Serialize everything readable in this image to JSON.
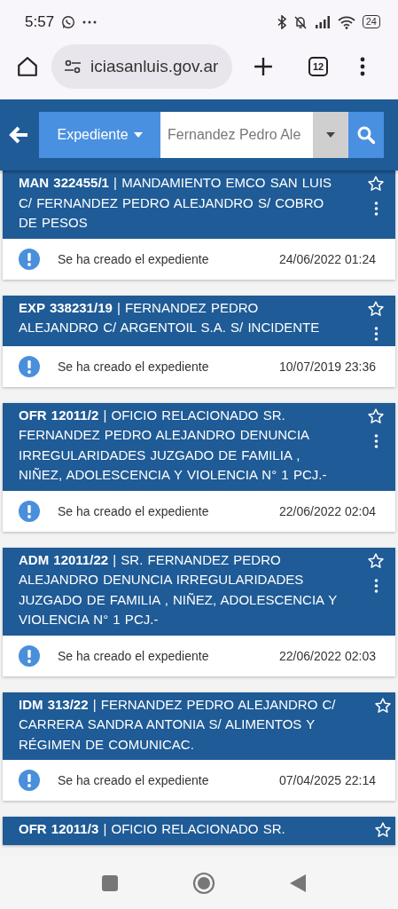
{
  "status_bar": {
    "time": "5:57",
    "battery": "24"
  },
  "browser": {
    "url": "iciasanluis.gov.ar",
    "tab_count": "12"
  },
  "search": {
    "category": "Expediente",
    "value": "Fernandez Pedro Ale"
  },
  "cards": [
    {
      "title": "**MAN 322455/1**   |   MANDAMIENTO EMCO SAN LUIS C/ FERNANDEZ PEDRO ALEJANDRO S/ COBRO DE PESOS",
      "starred": false,
      "menu": true,
      "event": "Se ha creado el expediente",
      "date": "24/06/2022 01:24"
    },
    {
      "title": "**EXP 338231/19**   |   FERNANDEZ PEDRO ALEJANDRO C/ ARGENTOIL S.A. S/ INCIDENTE",
      "starred": false,
      "menu": true,
      "event": "Se ha creado el expediente",
      "date": "10/07/2019 23:36"
    },
    {
      "title": "**OFR 12011/2**   |   OFICIO RELACIONADO SR. FERNANDEZ PEDRO ALEJANDRO DENUNCIA IRREGULARIDADES JUZGADO DE FAMILIA , NIÑEZ, ADOLESCENCIA Y VIOLENCIA N° 1 PCJ.-",
      "starred": false,
      "menu": true,
      "event": "Se ha creado el expediente",
      "date": "22/06/2022 02:04"
    },
    {
      "title": "**ADM 12011/22**   |   SR. FERNANDEZ PEDRO ALEJANDRO DENUNCIA IRREGULARIDADES JUZGADO DE FAMILIA , NIÑEZ, ADOLESCENCIA Y VIOLENCIA N° 1 PCJ.-",
      "starred": false,
      "menu": true,
      "event": "Se ha creado el expediente",
      "date": "22/06/2022 02:03"
    },
    {
      "title": "**IDM 313/22**   |   FERNANDEZ PEDRO ALEJANDRO C/ CARRERA SANDRA ANTONIA S/ ALIMENTOS Y RÉGIMEN DE COMUNICAC.",
      "starred": false,
      "menu": false,
      "event": "Se ha creado el expediente",
      "date": "07/04/2025 22:14"
    },
    {
      "title": "**OFR 12011/3**   |   OFICIO RELACIONADO SR.",
      "starred": false,
      "menu": false
    }
  ]
}
